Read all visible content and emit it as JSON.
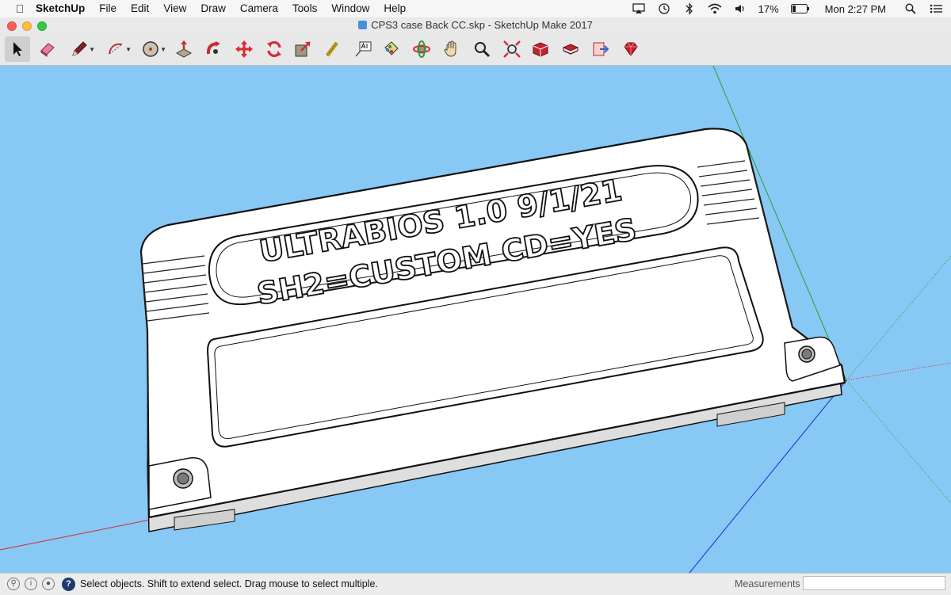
{
  "menubar": {
    "apple_icon": "apple-icon",
    "app_name": "SketchUp",
    "menus": [
      "File",
      "Edit",
      "View",
      "Draw",
      "Camera",
      "Tools",
      "Window",
      "Help"
    ],
    "battery": "17%",
    "clock": "Mon 2:27 PM"
  },
  "window": {
    "title": "CPS3 case Back CC.skp - SketchUp Make 2017"
  },
  "toolbar": {
    "tools": [
      "select",
      "eraser",
      "line",
      "arc",
      "shapes",
      "push-pull",
      "follow-me",
      "move",
      "rotate",
      "scale",
      "tape-measure",
      "text",
      "paint-bucket",
      "orbit",
      "pan",
      "zoom",
      "zoom-extents",
      "warehouse",
      "extension-warehouse",
      "send-to-layout",
      "ruby-console"
    ]
  },
  "model": {
    "line1": "ULTRABIOS 1.0 9/1/21",
    "line2": "SH2=CUSTOM  CD=YES"
  },
  "statusbar": {
    "message": "Select objects. Shift to extend select. Drag mouse to select multiple.",
    "measurements_label": "Measurements",
    "measurements_value": ""
  },
  "colors": {
    "viewport_bg": "#88c8f4",
    "axis_green": "#2aa02a",
    "axis_red": "#d22b2b",
    "axis_blue": "#1a2bd4"
  }
}
